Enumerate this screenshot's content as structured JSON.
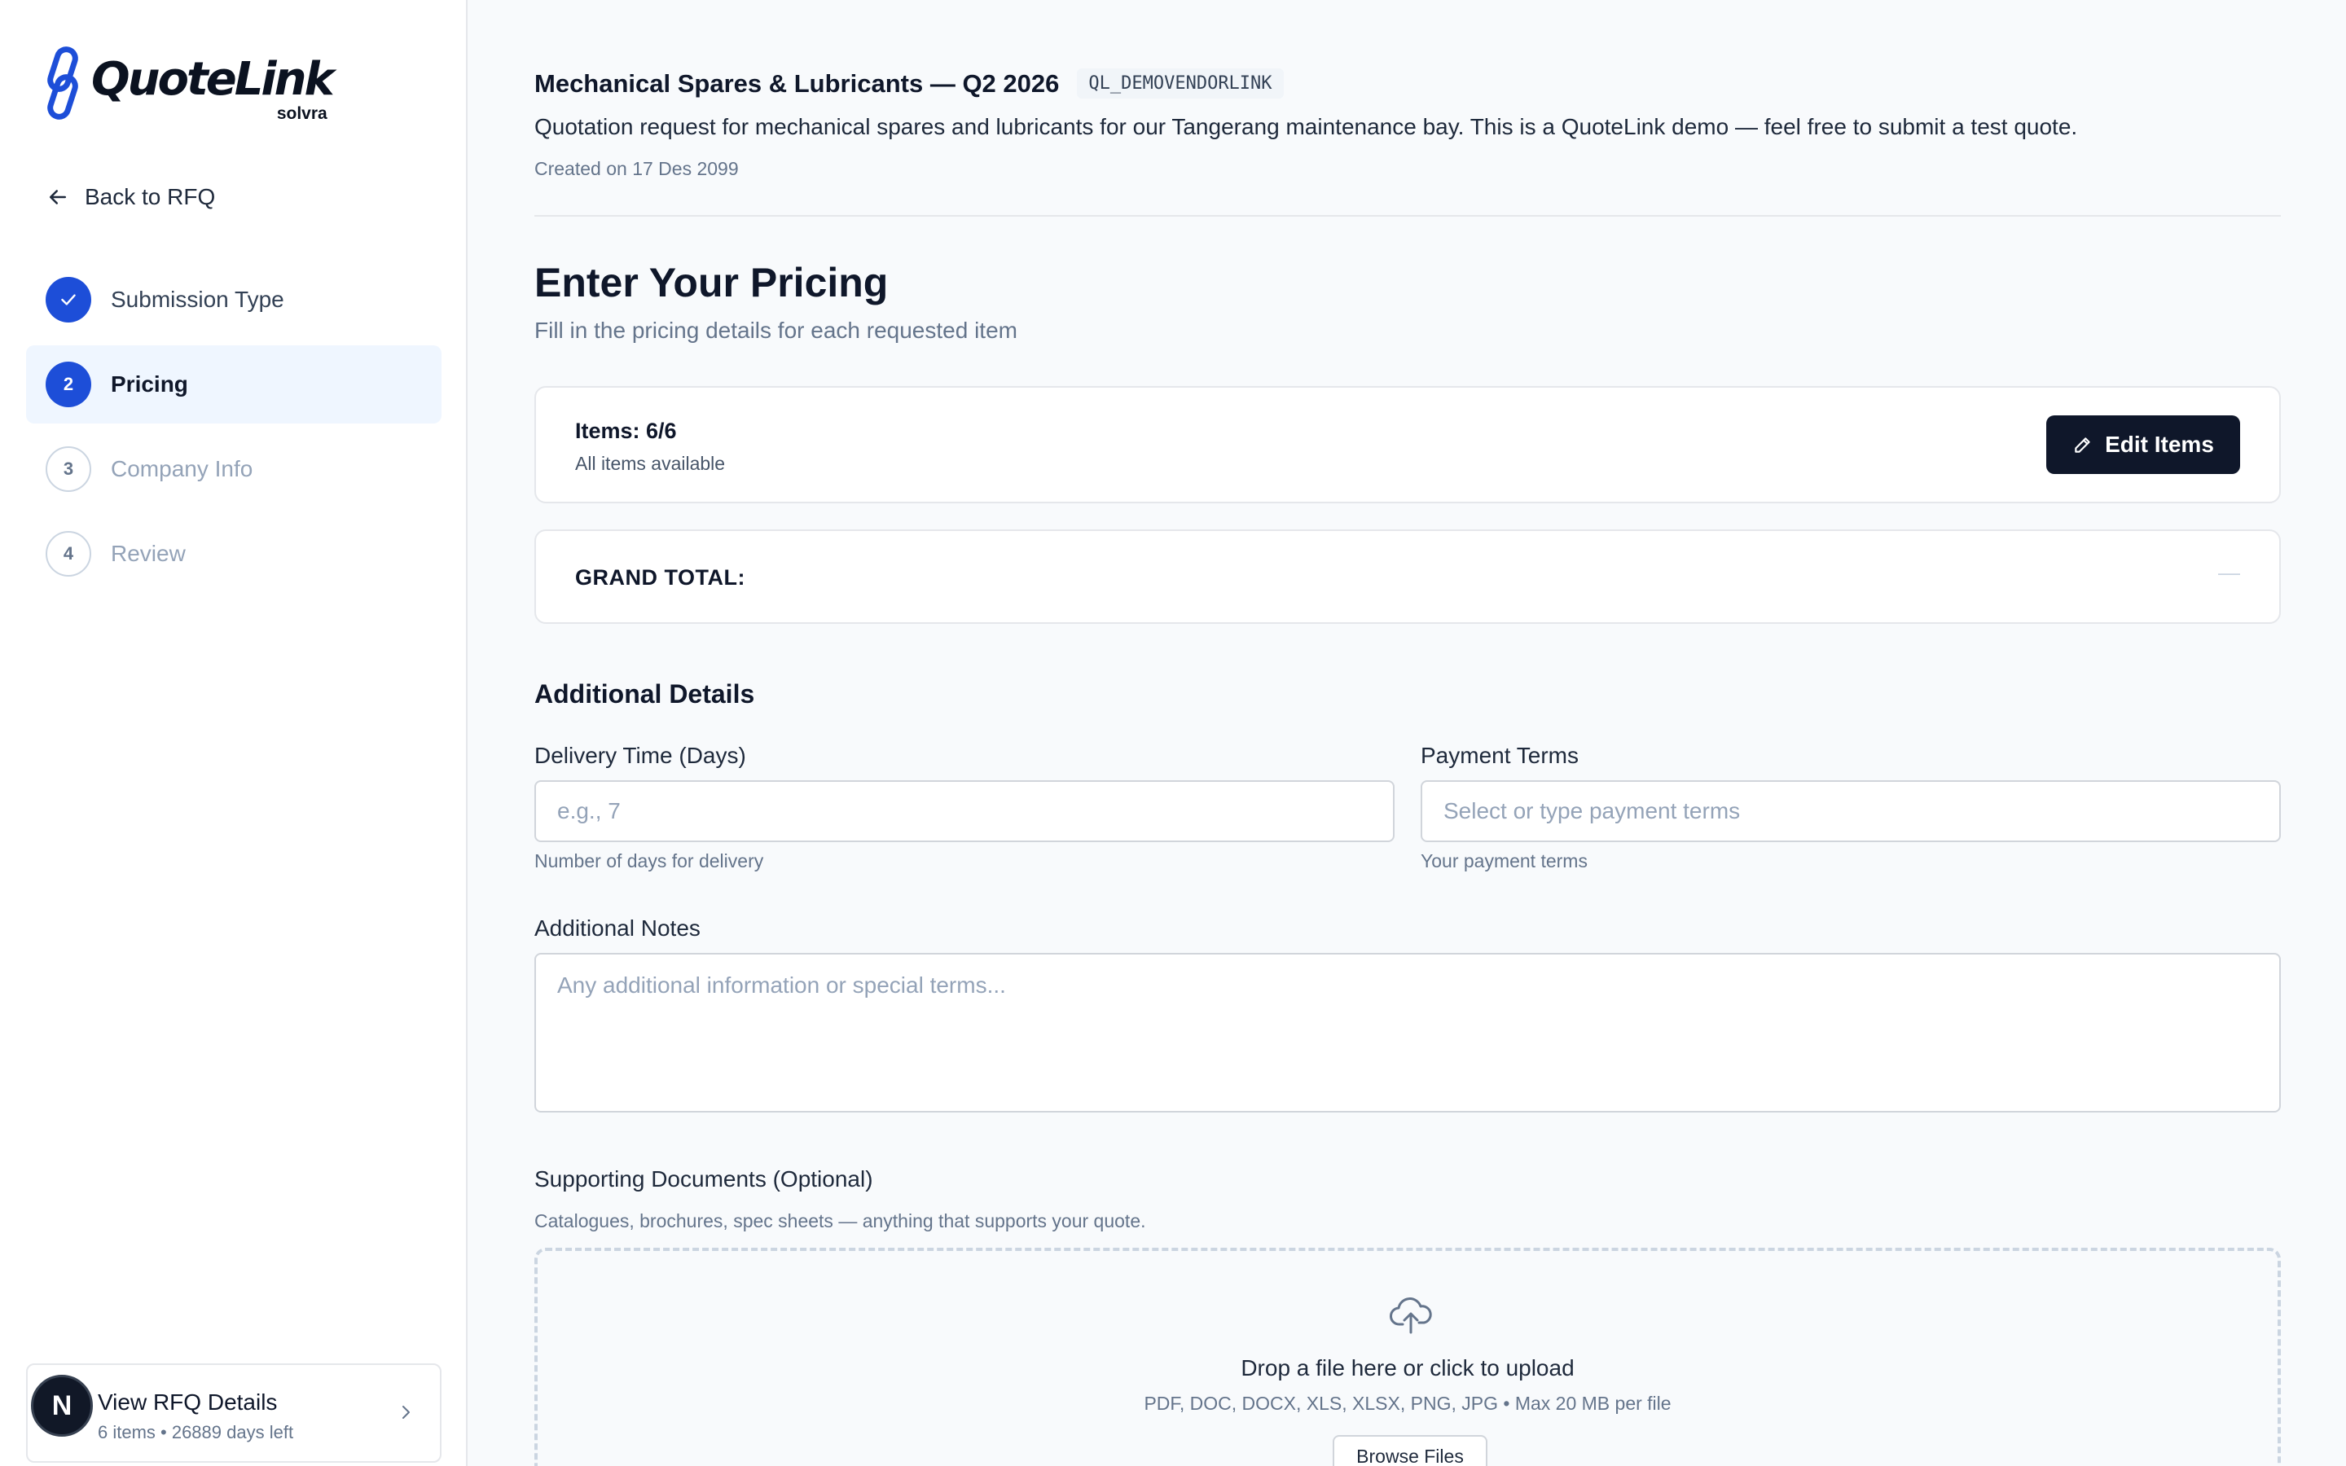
{
  "brand": {
    "name": "QuoteLink",
    "sub": "solvra"
  },
  "sidebar": {
    "back_label": "Back to RFQ",
    "steps": [
      {
        "number": "1",
        "label": "Submission Type",
        "state": "done"
      },
      {
        "number": "2",
        "label": "Pricing",
        "state": "current"
      },
      {
        "number": "3",
        "label": "Company Info",
        "state": "todo"
      },
      {
        "number": "4",
        "label": "Review",
        "state": "todo"
      }
    ],
    "rfq_card": {
      "avatar_letter": "N",
      "title": "View RFQ Details",
      "meta": "6 items • 26889 days left"
    }
  },
  "header": {
    "title": "Mechanical Spares & Lubricants — Q2 2026",
    "code": "QL_DEMOVENDORLINK",
    "description": "Quotation request for mechanical spares and lubricants for our Tangerang maintenance bay. This is a QuoteLink demo — feel free to submit a test quote.",
    "created": "Created on 17 Des 2099"
  },
  "pricing": {
    "title": "Enter Your Pricing",
    "subtitle": "Fill in the pricing details for each requested item",
    "items_count": "Items: 6/6",
    "items_status": "All items available",
    "edit_label": "Edit Items",
    "grand_total_label": "GRAND TOTAL:",
    "grand_total_value": "—"
  },
  "details": {
    "title": "Additional Details",
    "delivery": {
      "label": "Delivery Time (Days)",
      "placeholder": "e.g., 7",
      "help": "Number of days for delivery",
      "value": ""
    },
    "payment": {
      "label": "Payment Terms",
      "placeholder": "Select or type payment terms",
      "help": "Your payment terms",
      "value": ""
    },
    "notes": {
      "label": "Additional Notes",
      "placeholder": "Any additional information or special terms..."
    }
  },
  "documents": {
    "title": "Supporting Documents (Optional)",
    "subtitle": "Catalogues, brochures, spec sheets — anything that supports your quote.",
    "drop_text": "Drop a file here or click to upload",
    "drop_help": "PDF, DOC, DOCX, XLS, XLSX, PNG, JPG • Max 20 MB per file",
    "browse_label": "Browse Files"
  },
  "colors": {
    "accent": "#1d4ed8",
    "dark": "#0f172a",
    "active_bg": "#eff6ff"
  },
  "icons": {
    "back": "arrow-left-icon",
    "done": "check-icon",
    "edit": "pencil-icon",
    "upload": "cloud-upload-icon",
    "chevron": "chevron-right-icon"
  }
}
